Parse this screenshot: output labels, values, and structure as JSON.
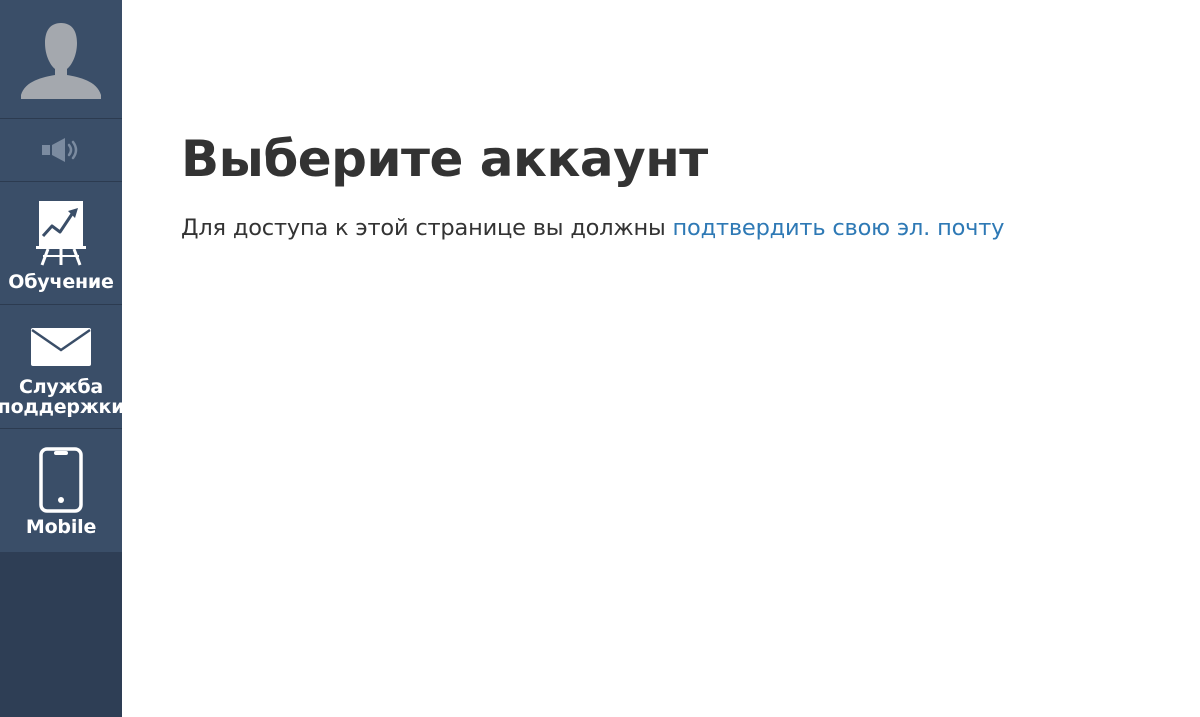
{
  "sidebar": {
    "items": [
      {
        "id": "avatar",
        "icon": "user-avatar-icon"
      },
      {
        "id": "sound",
        "icon": "speaker-icon"
      },
      {
        "id": "learning",
        "icon": "presentation-chart-icon",
        "label": "Обучение"
      },
      {
        "id": "support",
        "icon": "envelope-icon",
        "label": "Служба\nподдержки"
      },
      {
        "id": "mobile",
        "icon": "mobile-phone-icon",
        "label": "Mobile"
      }
    ],
    "colors": {
      "background": "#2e3e55",
      "item_background": "#3a4e68",
      "label": "#ffffff"
    }
  },
  "main": {
    "title": "Выберите аккаунт",
    "description_prefix": "Для доступа к этой странице вы должны ",
    "verify_link": "подтвердить свою эл. почту",
    "colors": {
      "text": "#333333",
      "link": "#2e79b5"
    }
  }
}
